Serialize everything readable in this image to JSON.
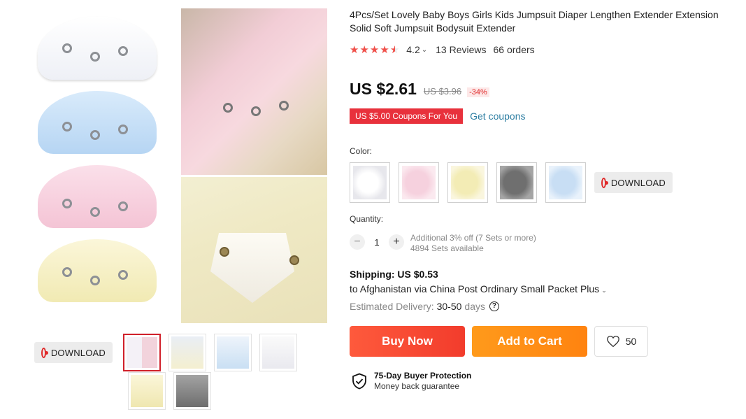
{
  "product": {
    "title": "4Pcs/Set Lovely Baby Boys Girls Kids Jumpsuit Diaper Lengthen Extender Extension Solid Soft Jumpsuit Bodysuit Extender",
    "rating": 4.2,
    "rating_label": "4.2",
    "reviews": "13 Reviews",
    "orders": "66 orders",
    "price": "US $2.61",
    "old_price": "US $3.96",
    "discount": "-34%",
    "accent_color": "#e8313c"
  },
  "coupon": {
    "label": "US $5.00 Coupons For You",
    "link": "Get coupons"
  },
  "color": {
    "label": "Color:",
    "options": [
      "white",
      "pink",
      "yellow",
      "gray",
      "blue"
    ],
    "download_label": "DOWNLOAD"
  },
  "quantity": {
    "label": "Quantity:",
    "value": "1",
    "minus": "−",
    "plus": "+",
    "promo": "Additional 3% off (7 Sets or more)",
    "available": "4894 Sets available"
  },
  "shipping": {
    "title": "Shipping: US $0.53",
    "route": "to Afghanistan via China Post Ordinary Small Packet Plus",
    "delivery_label": "Estimated Delivery:",
    "delivery_value": "30-50",
    "delivery_unit": "days"
  },
  "actions": {
    "buy_now": "Buy Now",
    "add_to_cart": "Add to Cart",
    "wishlist_count": "50"
  },
  "protection": {
    "title": "75-Day Buyer Protection",
    "subtitle": "Money back guarantee"
  },
  "gallery": {
    "download_label": "DOWNLOAD",
    "thumbnail_count": 6,
    "active_index": 0
  },
  "icons": [
    "download-icon",
    "star-icon",
    "chevron-down-icon",
    "help-icon",
    "heart-icon",
    "shield-check-icon"
  ]
}
